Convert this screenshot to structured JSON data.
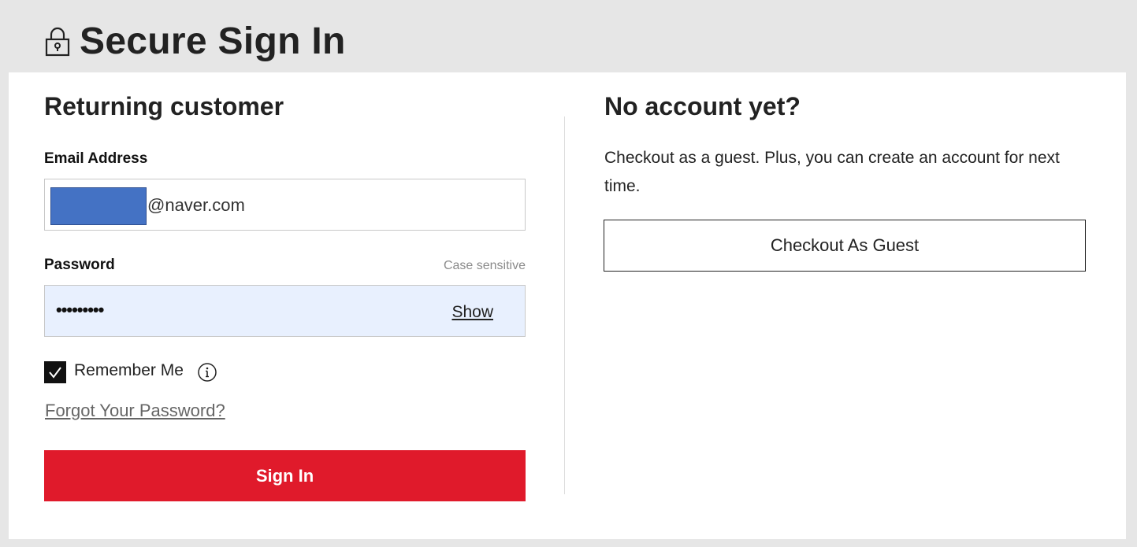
{
  "header": {
    "icon": "lock-icon",
    "title": "Secure Sign In"
  },
  "returning": {
    "heading": "Returning customer",
    "email": {
      "label": "Email Address",
      "value_visible": "@naver.com"
    },
    "password": {
      "label": "Password",
      "hint": "Case sensitive",
      "masked_value": "•••••••••",
      "show_label": "Show"
    },
    "remember": {
      "label": "Remember Me",
      "checked": true,
      "info_icon": "info-icon"
    },
    "forgot_label": "Forgot Your Password?",
    "signin_label": "Sign In"
  },
  "guest": {
    "heading": "No account yet?",
    "text": "Checkout as a guest. Plus, you can create an account for next time.",
    "button_label": "Checkout As Guest"
  },
  "colors": {
    "accent_red": "#e01a2b",
    "page_bg": "#e6e6e6",
    "autofill_bg": "#e8f0fe",
    "redaction_blue": "#4472c4"
  }
}
